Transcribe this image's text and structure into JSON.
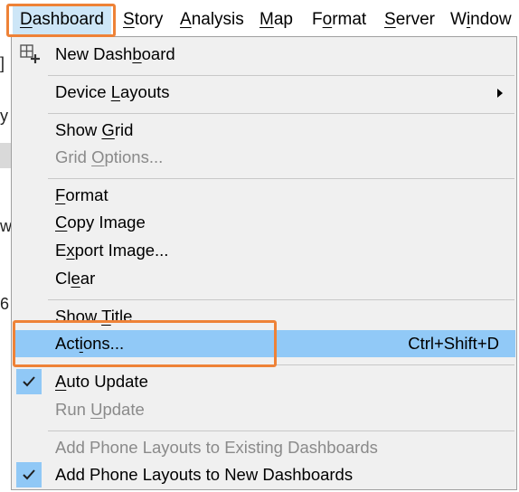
{
  "menubar": {
    "items": [
      {
        "label": "Dashboard",
        "mnemonic_index": 0
      },
      {
        "label": "Story",
        "mnemonic_index": 0
      },
      {
        "label": "Analysis",
        "mnemonic_index": 0
      },
      {
        "label": "Map",
        "mnemonic_index": 0
      },
      {
        "label": "Format",
        "mnemonic_index": 1
      },
      {
        "label": "Server",
        "mnemonic_index": 0
      },
      {
        "label": "Window",
        "mnemonic_index": 1
      }
    ],
    "active": "Dashboard"
  },
  "background_fragments": [
    "]",
    "y",
    "w",
    "6"
  ],
  "dropdown": {
    "items": [
      {
        "label": "New Dashboard",
        "icon": "new-dashboard-icon"
      },
      {
        "label": "Device Layouts",
        "submenu": true
      },
      {
        "label": "Show Grid"
      },
      {
        "label": "Grid Options...",
        "disabled": true
      },
      {
        "label": "Format"
      },
      {
        "label": "Copy Image"
      },
      {
        "label": "Export Image..."
      },
      {
        "label": "Clear"
      },
      {
        "label": "Show Title"
      },
      {
        "label": "Actions...",
        "accelerator": "Ctrl+Shift+D",
        "highlighted": true
      },
      {
        "label": "Auto Update",
        "checked": true
      },
      {
        "label": "Run Update",
        "disabled": true
      },
      {
        "label": "Add Phone Layouts to Existing Dashboards",
        "disabled": true
      },
      {
        "label": "Add Phone Layouts to New Dashboards",
        "checked": true
      }
    ]
  },
  "colors": {
    "menu_background": "#f0f0f0",
    "highlight": "#91c9f7",
    "active_menubar": "#cde6f7",
    "callout": "#ee8237",
    "disabled_text": "#8a8a8a"
  }
}
